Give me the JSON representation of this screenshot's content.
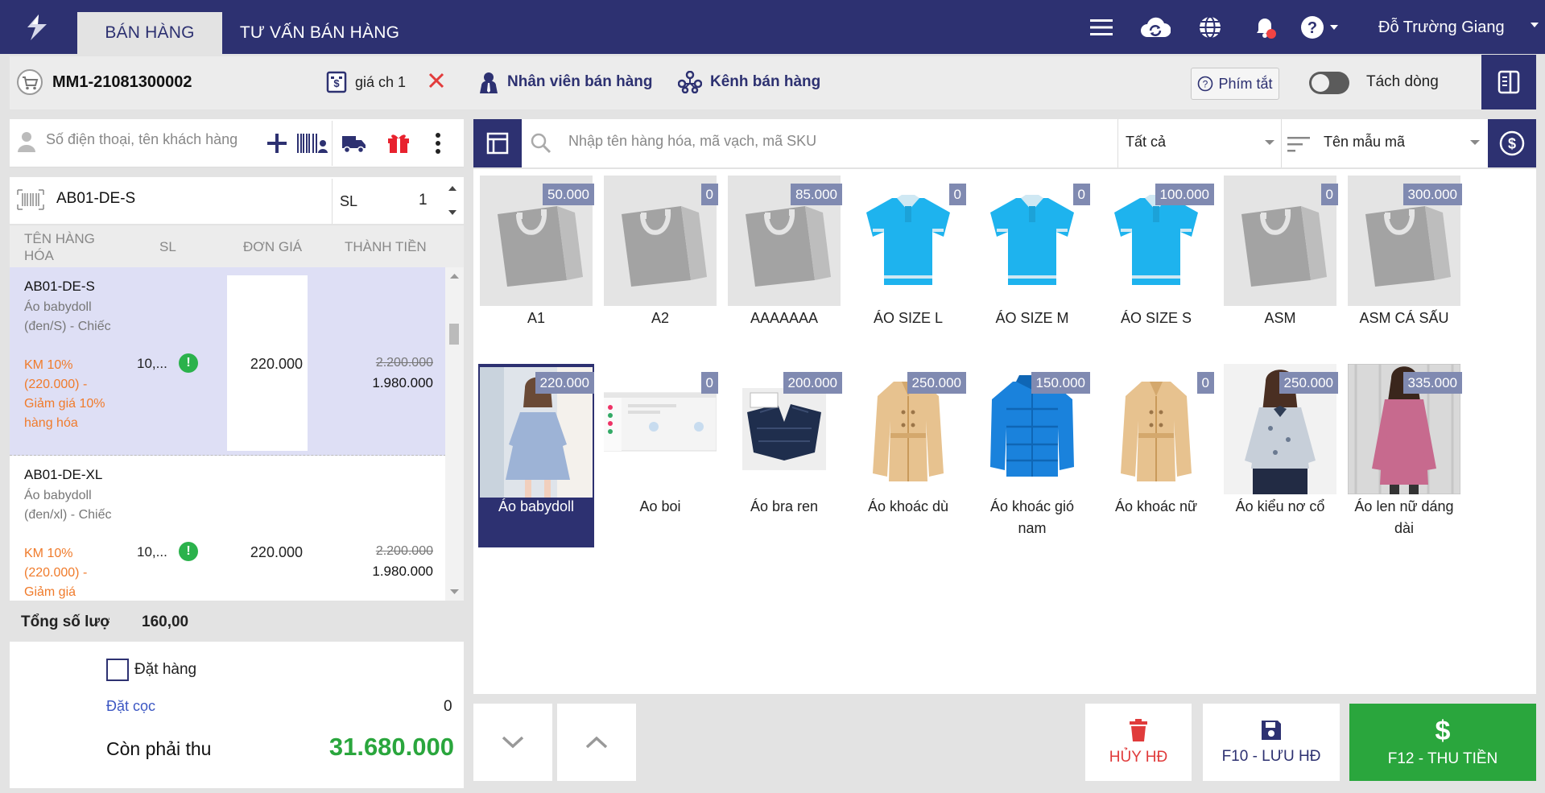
{
  "header": {
    "tabs": [
      "BÁN HÀNG",
      "TƯ VẤN BÁN HÀNG"
    ],
    "active_tab": "BÁN HÀNG",
    "user_name": "Đỗ Trường Giang",
    "icons": [
      "menu-icon",
      "cloud-sync-icon",
      "globe-icon",
      "bell-icon",
      "help-icon"
    ]
  },
  "toolbar": {
    "invoice_code": "MM1-21081300002",
    "price_book": "giá ch 1",
    "staff_label": "Nhân viên bán hàng",
    "channel_label": "Kênh bán hàng",
    "shortcut_label": "Phím tắt",
    "split_label": "Tách dòng",
    "split_enabled": false
  },
  "customer": {
    "placeholder": "Số điện thoại, tên khách hàng"
  },
  "entry": {
    "code": "AB01-DE-S",
    "qty_label": "SL",
    "qty": "1"
  },
  "cart": {
    "headers": [
      "TÊN HÀNG HÓA",
      "SL",
      "ĐƠN GIÁ",
      "THÀNH TIỀN"
    ],
    "rows": [
      {
        "code": "AB01-DE-S",
        "desc": "Áo babydoll (đen/S) - Chiếc",
        "promo": "KM 10% (220.000) - Giảm giá 10% hàng hóa",
        "qty": "10,...",
        "price": "220.000",
        "total_old": "2.200.000",
        "total": "1.980.000",
        "selected": true
      },
      {
        "code": "AB01-DE-XL",
        "desc": "Áo babydoll (đen/xl) - Chiếc",
        "promo": "KM 10% (220.000) - Giảm giá",
        "qty": "10,...",
        "price": "220.000",
        "total_old": "2.200.000",
        "total": "1.980.000",
        "selected": false
      }
    ],
    "total_qty_label": "Tổng số lượng",
    "total_qty": "160,00"
  },
  "payment": {
    "order_label": "Đặt hàng",
    "order_checked": false,
    "deposit_label": "Đặt cọc",
    "deposit_value": "0",
    "remaining_label": "Còn phải thu",
    "remaining_value": "31.680.000"
  },
  "search": {
    "placeholder": "Nhập tên hàng hóa, mã vạch, mã SKU",
    "filter": "Tất cả",
    "sort": "Tên mẫu mã"
  },
  "products": [
    {
      "name": "A1",
      "price": "50.000",
      "image": "bag"
    },
    {
      "name": "A2",
      "price": "0",
      "image": "bag"
    },
    {
      "name": "AAAAAAA",
      "price": "85.000",
      "image": "bag"
    },
    {
      "name": "ÁO SIZE L",
      "price": "0",
      "image": "polo"
    },
    {
      "name": "ÁO SIZE M",
      "price": "0",
      "image": "polo"
    },
    {
      "name": "ÁO SIZE S",
      "price": "100.000",
      "image": "polo"
    },
    {
      "name": "ASM",
      "price": "0",
      "image": "bag"
    },
    {
      "name": "ASM CÁ SẤU",
      "price": "300.000",
      "image": "bag"
    },
    {
      "name": "Áo babydoll",
      "price": "220.000",
      "image": "photo-dress",
      "selected": true
    },
    {
      "name": "Ao boi",
      "price": "0",
      "image": "screenshot"
    },
    {
      "name": "Áo bra ren",
      "price": "200.000",
      "image": "photo-bra"
    },
    {
      "name": "Áo khoác dù",
      "price": "250.000",
      "image": "coat"
    },
    {
      "name": "Áo khoác gió nam",
      "price": "150.000",
      "image": "puffer"
    },
    {
      "name": "Áo khoác nữ",
      "price": "0",
      "image": "coat"
    },
    {
      "name": "Áo kiểu nơ cổ",
      "price": "250.000",
      "image": "photo-blouse"
    },
    {
      "name": "Áo len nữ dáng dài",
      "price": "335.000",
      "image": "photo-sweater"
    }
  ],
  "actions": {
    "cancel": "HỦY HĐ",
    "save": "F10 - LƯU HĐ",
    "pay": "F12 - THU TIỀN"
  },
  "colors": {
    "brand": "#2d3171",
    "pay_green": "#2aa63d",
    "cancel_red": "#e03b3b",
    "promo_orange": "#f07b2b",
    "price_tag": "#808ab1"
  }
}
